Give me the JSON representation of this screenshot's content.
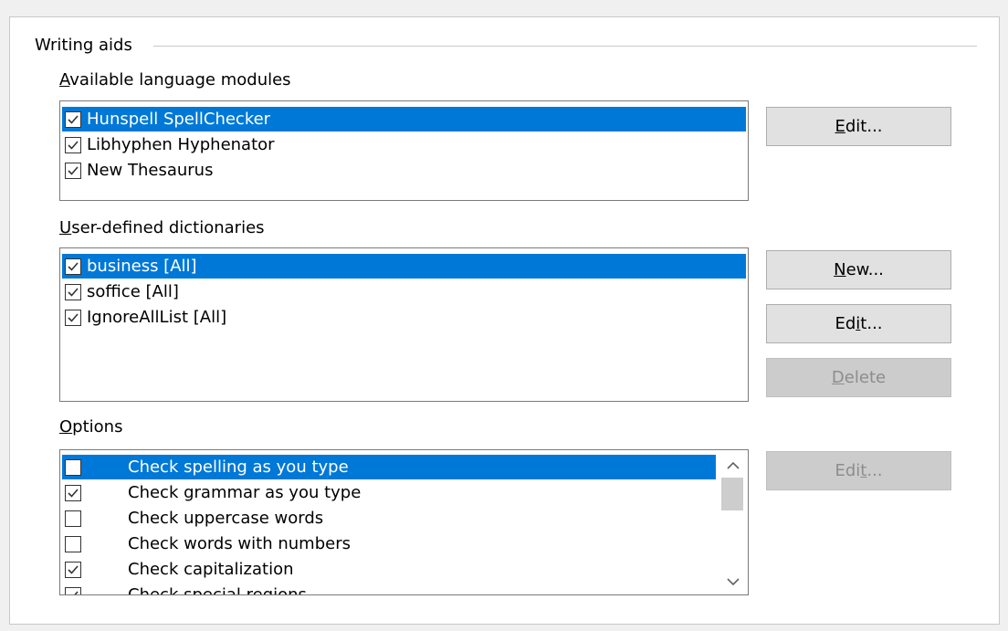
{
  "group": {
    "title": "Writing aids"
  },
  "modules": {
    "label_pre": "",
    "label_key": "A",
    "label_post": "vailable language modules",
    "items": [
      {
        "label": "Hunspell SpellChecker",
        "checked": true,
        "selected": true
      },
      {
        "label": "Libhyphen Hyphenator",
        "checked": true,
        "selected": false
      },
      {
        "label": "New Thesaurus",
        "checked": true,
        "selected": false
      }
    ],
    "edit_pre": "",
    "edit_key": "E",
    "edit_post": "dit..."
  },
  "dictionaries": {
    "label_pre": "",
    "label_key": "U",
    "label_post": "ser-defined dictionaries",
    "items": [
      {
        "label": "business [All]",
        "checked": true,
        "selected": true
      },
      {
        "label": "soffice [All]",
        "checked": true,
        "selected": false
      },
      {
        "label": "IgnoreAllList [All]",
        "checked": true,
        "selected": false
      }
    ],
    "new_pre": "",
    "new_key": "N",
    "new_post": "ew...",
    "edit_pre": "Ed",
    "edit_key": "i",
    "edit_post": "t...",
    "delete_pre": "",
    "delete_key": "D",
    "delete_post": "elete"
  },
  "options": {
    "label_pre": "",
    "label_key": "O",
    "label_post": "ptions",
    "items": [
      {
        "label": "Check spelling as you type",
        "checked": false,
        "selected": true
      },
      {
        "label": "Check grammar as you type",
        "checked": true,
        "selected": false
      },
      {
        "label": "Check uppercase words",
        "checked": false,
        "selected": false
      },
      {
        "label": "Check words with numbers",
        "checked": false,
        "selected": false
      },
      {
        "label": "Check capitalization",
        "checked": true,
        "selected": false
      },
      {
        "label": "Check special regions",
        "checked": true,
        "selected": false
      }
    ],
    "edit_pre": "Edi",
    "edit_key": "t",
    "edit_post": "..."
  },
  "icons": {
    "check": "checkmark-icon",
    "up": "chevron-up-icon",
    "down": "chevron-down-icon"
  },
  "colors": {
    "selection": "#0078d7"
  }
}
